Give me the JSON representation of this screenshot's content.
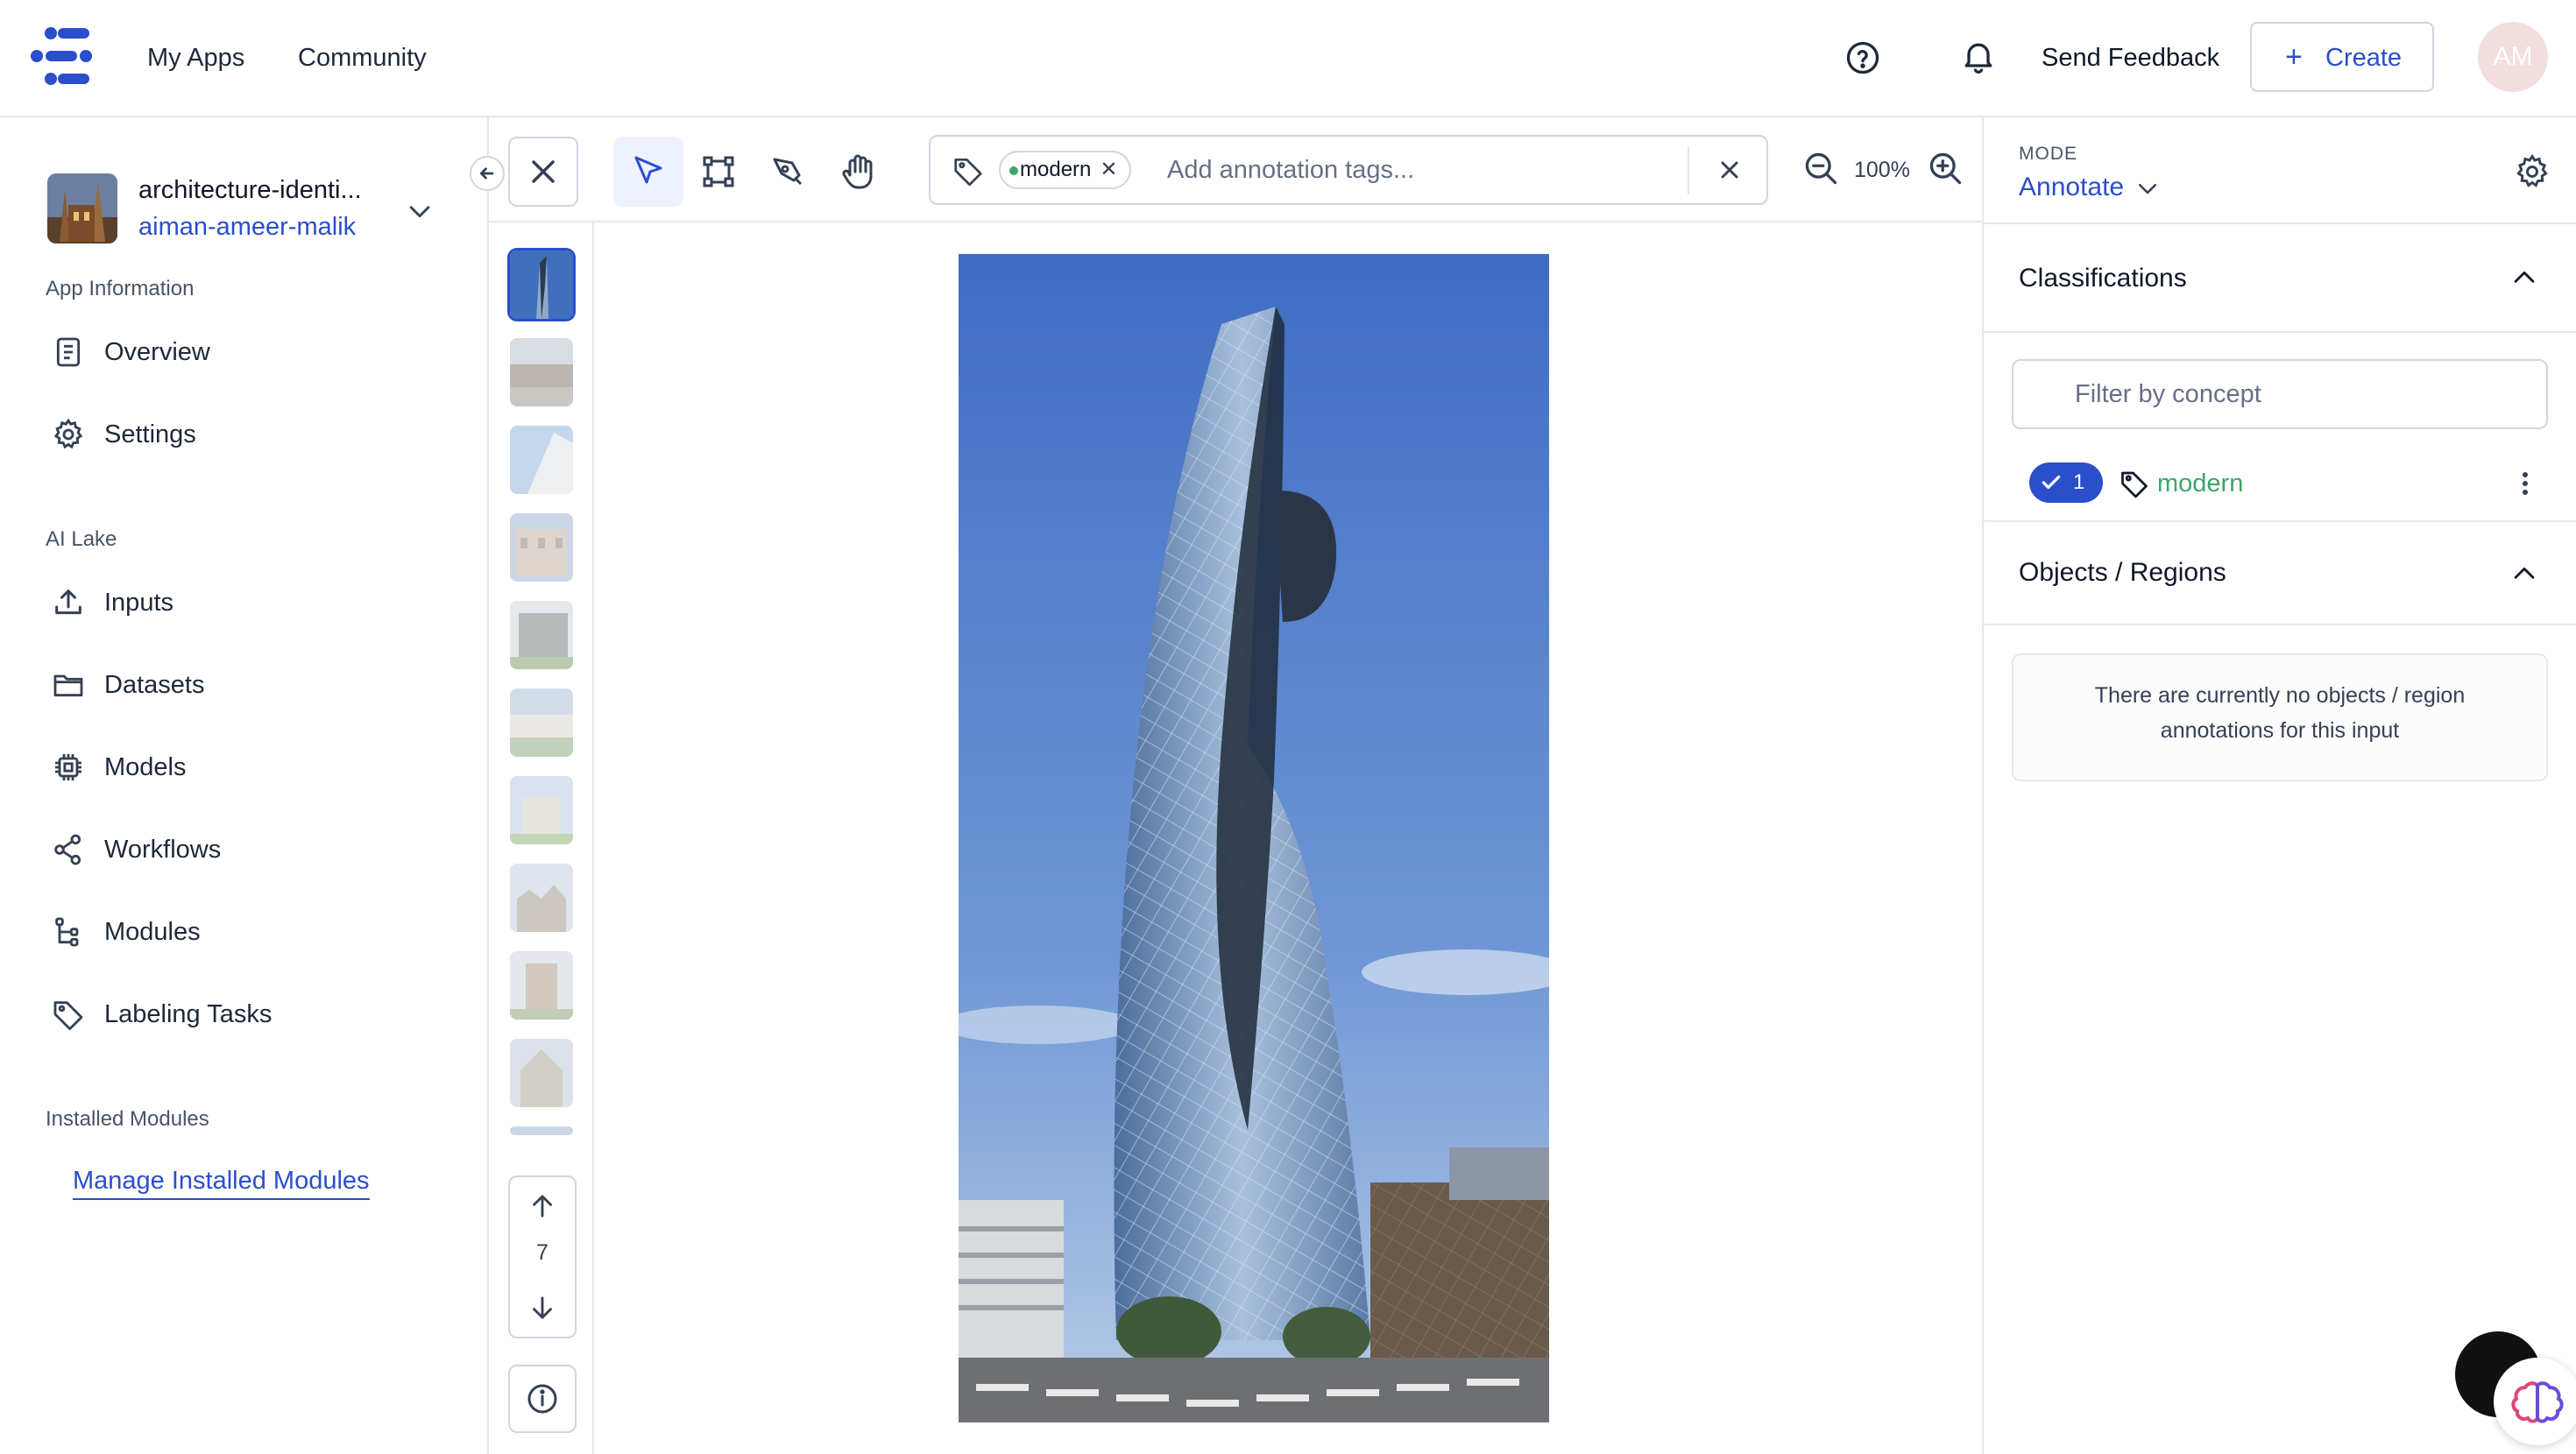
{
  "nav": {
    "my_apps": "My Apps",
    "community": "Community",
    "send_feedback": "Send Feedback",
    "create_label": "Create",
    "avatar_initials": "AM"
  },
  "app": {
    "name": "architecture-identi...",
    "user": "aiman-ameer-malik"
  },
  "sidebar": {
    "section_app_info": "App Information",
    "app_info_items": [
      {
        "label": "Overview",
        "icon": "document-icon"
      },
      {
        "label": "Settings",
        "icon": "gear-icon"
      }
    ],
    "section_ai_lake": "AI Lake",
    "ai_lake_items": [
      {
        "label": "Inputs",
        "icon": "upload-icon"
      },
      {
        "label": "Datasets",
        "icon": "folder-icon"
      },
      {
        "label": "Models",
        "icon": "chip-icon"
      },
      {
        "label": "Workflows",
        "icon": "share-nodes-icon"
      },
      {
        "label": "Modules",
        "icon": "tree-icon"
      },
      {
        "label": "Labeling Tasks",
        "icon": "tag-icon"
      }
    ],
    "section_installed": "Installed Modules",
    "manage_modules": "Manage Installed Modules"
  },
  "toolbar": {
    "tag_chip": "modern",
    "tag_placeholder": "Add annotation tags...",
    "zoom": "100%"
  },
  "pager": {
    "current": "7"
  },
  "right_panel": {
    "mode_label": "MODE",
    "mode_value": "Annotate",
    "classifications_heading": "Classifications",
    "filter_placeholder": "Filter by concept",
    "classification": {
      "count": "1",
      "name": "modern"
    },
    "objects_heading": "Objects / Regions",
    "empty_line1": "There are currently no objects / region",
    "empty_line2": "annotations for this input"
  },
  "colors": {
    "accent": "#2b4ecb",
    "concept_green": "#3aa66b",
    "border": "#d0d5dd"
  }
}
